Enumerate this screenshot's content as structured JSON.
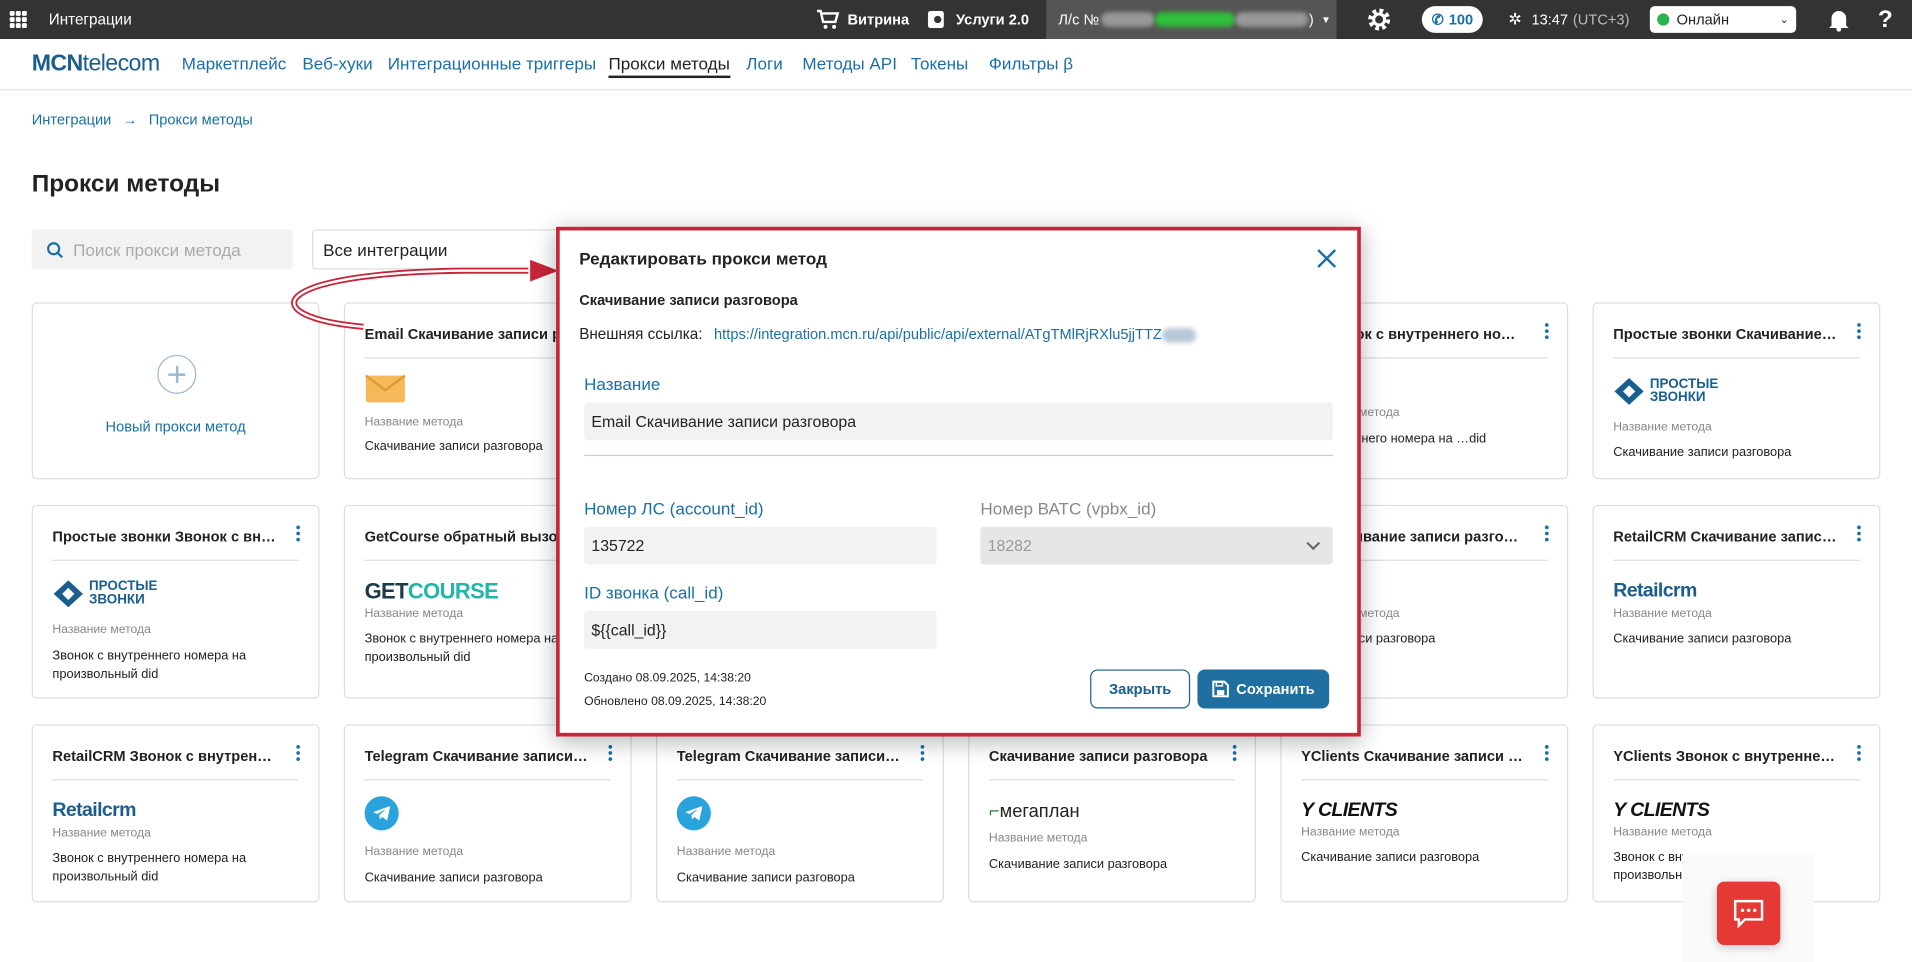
{
  "topbar": {
    "app_title": "Интеграции",
    "showcase_label": "Витрина",
    "services_label": "Услуги 2.0",
    "account_prefix": "Л/с №",
    "account_suffix": ")",
    "calls_count": "100",
    "time": "13:47",
    "timezone": "(UTC+3)",
    "status_value": "Онлайн",
    "help_label": "?"
  },
  "nav": {
    "logo_bold": "MCN",
    "logo_rest": "telecom",
    "links": [
      "Маркетплейс",
      "Веб-хуки",
      "Интеграционные триггеры",
      "Прокси методы",
      "Логи",
      "Методы API",
      "Токены",
      "Фильтры β"
    ]
  },
  "breadcrumb": {
    "root": "Интеграции",
    "arrow": "→",
    "current": "Прокси методы"
  },
  "page": {
    "title": "Прокси методы",
    "search_placeholder": "Поиск прокси метода",
    "filter_value": "Все интеграции",
    "new_card_label": "Новый прокси метод"
  },
  "method_label": "Название метода",
  "cards": [
    {
      "title": "Email Скачивание записи разговора",
      "brand": "email",
      "desc": "Скачивание записи разговора"
    },
    {
      "title": "… Звонок с внутреннего номера",
      "brand": "crm",
      "desc": "…внутреннего номера на …did"
    },
    {
      "title": "Простые звонки Скачивание записи разговора",
      "brand": "pz",
      "brand_top": "ПРОСТЫЕ",
      "brand_bottom": "ЗВОНКИ",
      "desc": "Скачивание записи разговора"
    },
    {
      "title": "Простые звонки Звонок с внутреннего номера",
      "brand": "pz",
      "brand_top": "ПРОСТЫЕ",
      "brand_bottom": "ЗВОНКИ",
      "desc": "Звонок с внутреннего номера на произвольный did"
    },
    {
      "title": "GetCourse обратный вызо",
      "brand": "gc",
      "brand_a": "GET",
      "brand_b": "COURSE",
      "desc": "Звонок с внутреннего номера на произвольный did"
    },
    {
      "title": "… Скачивание записи разговора",
      "brand": "dots",
      "brand_text": "‥",
      "desc": "…ие записи разговора"
    },
    {
      "title": "RetailCRM Скачивание записи разговора",
      "brand": "retail",
      "brand_text": "Retailcrm",
      "desc": "Скачивание записи разговора"
    },
    {
      "title": "RetailCRM Звонок с внутреннего номера",
      "brand": "retail",
      "brand_text": "Retailcrm",
      "desc": "Звонок с внутреннего номера на произвольный did"
    },
    {
      "title": "Telegram Скачивание записи разговора",
      "brand": "tg",
      "desc": "Скачивание записи разговора"
    },
    {
      "title": "Telegram Скачивание записи разговора",
      "brand": "tg",
      "desc": "Скачивание записи разговора"
    },
    {
      "title": "Скачивание записи разговора",
      "brand": "mp",
      "brand_text": "мегаплан",
      "desc": "Скачивание записи разговора"
    },
    {
      "title": "YClients Скачивание записи разговора",
      "brand": "yc",
      "brand_text": "Y CLIENTS",
      "desc": "Скачивание записи разговора"
    },
    {
      "title": "YClients Звонок с внутреннего номера",
      "brand": "yc",
      "brand_text": "Y CLIENTS",
      "desc": "Звонок с внутреннего номера на произвольный did"
    }
  ],
  "modal": {
    "title": "Редактировать прокси метод",
    "subtitle": "Скачивание записи разговора",
    "ext_label": "Внешняя ссылка:",
    "ext_url": "https://integration.mcn.ru/api/public/api/external/ATgTMlRjRXlu5jjTTZ",
    "name_label": "Название",
    "name_value": "Email Скачивание записи разговора",
    "account_label": "Номер ЛС (account_id)",
    "account_value": "135722",
    "vpbx_label": "Номер ВАТС (vpbx_id)",
    "vpbx_value": "18282",
    "call_label": "ID звонка (call_id)",
    "call_value": "${{call_id}}",
    "created": "Создано 08.09.2025, 14:38:20",
    "updated": "Обновлено 08.09.2025, 14:38:20",
    "close_label": "Закрыть",
    "save_label": "Сохранить"
  },
  "colors": {
    "accent": "#1a6fa8",
    "highlight": "#c8243a",
    "topbar": "#333333",
    "fab": "#e53935"
  }
}
